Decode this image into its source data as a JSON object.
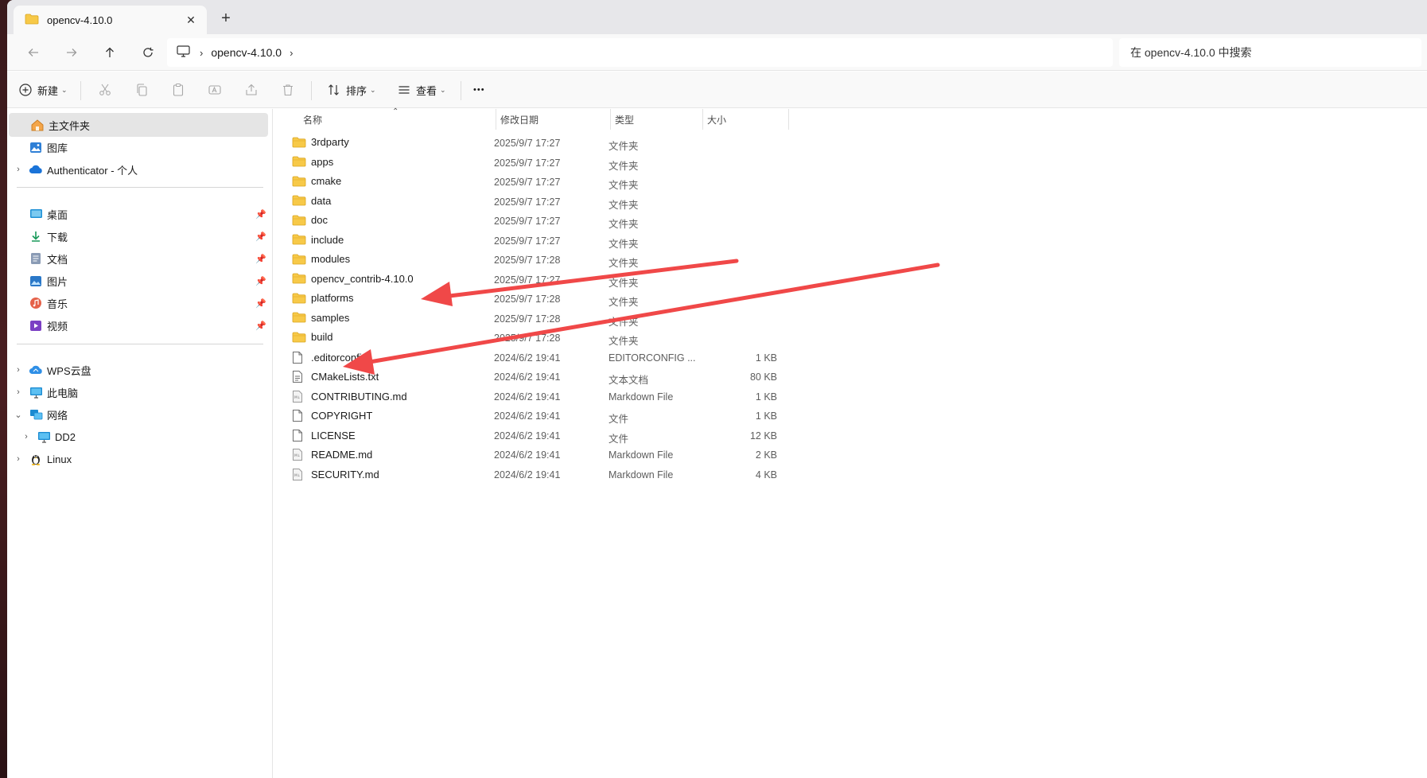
{
  "window": {
    "tab_title": "opencv-4.10.0",
    "close_label": "✕",
    "new_tab_label": "+"
  },
  "address": {
    "crumbs": [
      "opencv-4.10.0"
    ],
    "search_placeholder": "在 opencv-4.10.0 中搜索"
  },
  "toolbar": {
    "new_label": "新建",
    "sort_label": "排序",
    "view_label": "查看",
    "more_label": "•••"
  },
  "sidebar": {
    "home": "主文件夹",
    "gallery": "图库",
    "cloud": "Authenticator - 个人",
    "pinned": [
      {
        "label": "桌面",
        "icon": "desktop-icon"
      },
      {
        "label": "下载",
        "icon": "download-icon"
      },
      {
        "label": "文档",
        "icon": "document-icon"
      },
      {
        "label": "图片",
        "icon": "pictures-icon"
      },
      {
        "label": "音乐",
        "icon": "music-icon"
      },
      {
        "label": "视频",
        "icon": "video-icon"
      }
    ],
    "locations": [
      {
        "label": "WPS云盘",
        "icon": "cloud-icon"
      },
      {
        "label": "此电脑",
        "icon": "computer-icon"
      },
      {
        "label": "网络",
        "icon": "network-icon"
      },
      {
        "label": "DD2",
        "icon": "monitor-icon"
      },
      {
        "label": "Linux",
        "icon": "linux-icon"
      }
    ]
  },
  "columns": {
    "name": "名称",
    "date": "修改日期",
    "type": "类型",
    "size": "大小"
  },
  "files": [
    {
      "name": "3rdparty",
      "date": "2025/9/7 17:27",
      "type": "文件夹",
      "size": "",
      "kind": "folder"
    },
    {
      "name": "apps",
      "date": "2025/9/7 17:27",
      "type": "文件夹",
      "size": "",
      "kind": "folder"
    },
    {
      "name": "cmake",
      "date": "2025/9/7 17:27",
      "type": "文件夹",
      "size": "",
      "kind": "folder"
    },
    {
      "name": "data",
      "date": "2025/9/7 17:27",
      "type": "文件夹",
      "size": "",
      "kind": "folder"
    },
    {
      "name": "doc",
      "date": "2025/9/7 17:27",
      "type": "文件夹",
      "size": "",
      "kind": "folder"
    },
    {
      "name": "include",
      "date": "2025/9/7 17:27",
      "type": "文件夹",
      "size": "",
      "kind": "folder"
    },
    {
      "name": "modules",
      "date": "2025/9/7 17:28",
      "type": "文件夹",
      "size": "",
      "kind": "folder"
    },
    {
      "name": "opencv_contrib-4.10.0",
      "date": "2025/9/7 17:27",
      "type": "文件夹",
      "size": "",
      "kind": "folder"
    },
    {
      "name": "platforms",
      "date": "2025/9/7 17:28",
      "type": "文件夹",
      "size": "",
      "kind": "folder"
    },
    {
      "name": "samples",
      "date": "2025/9/7 17:28",
      "type": "文件夹",
      "size": "",
      "kind": "folder"
    },
    {
      "name": "build",
      "date": "2025/9/7 17:28",
      "type": "文件夹",
      "size": "",
      "kind": "folder"
    },
    {
      "name": ".editorconfig",
      "date": "2024/6/2 19:41",
      "type": "EDITORCONFIG ...",
      "size": "1 KB",
      "kind": "file"
    },
    {
      "name": "CMakeLists.txt",
      "date": "2024/6/2 19:41",
      "type": "文本文档",
      "size": "80 KB",
      "kind": "text"
    },
    {
      "name": "CONTRIBUTING.md",
      "date": "2024/6/2 19:41",
      "type": "Markdown File",
      "size": "1 KB",
      "kind": "md"
    },
    {
      "name": "COPYRIGHT",
      "date": "2024/6/2 19:41",
      "type": "文件",
      "size": "1 KB",
      "kind": "file"
    },
    {
      "name": "LICENSE",
      "date": "2024/6/2 19:41",
      "type": "文件",
      "size": "12 KB",
      "kind": "file"
    },
    {
      "name": "README.md",
      "date": "2024/6/2 19:41",
      "type": "Markdown File",
      "size": "2 KB",
      "kind": "md"
    },
    {
      "name": "SECURITY.md",
      "date": "2024/6/2 19:41",
      "type": "Markdown File",
      "size": "4 KB",
      "kind": "md"
    }
  ],
  "annotations": {
    "arrow_color": "#f04848"
  }
}
